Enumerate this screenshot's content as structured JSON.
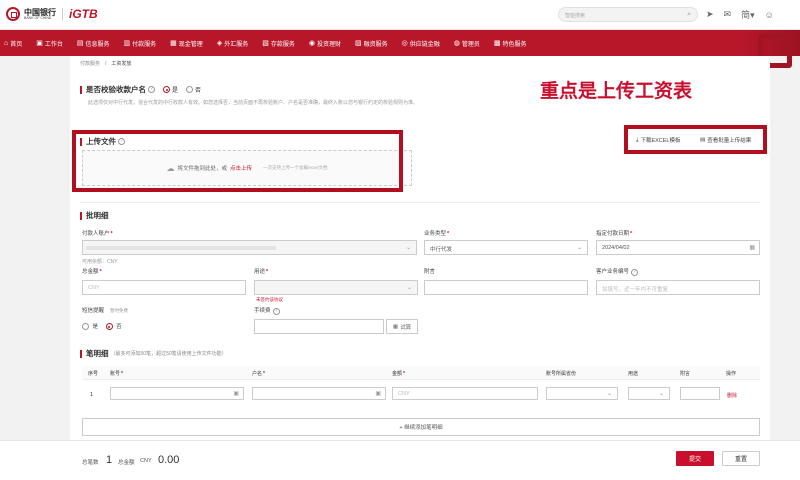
{
  "header": {
    "bank_name_cn": "中国银行",
    "bank_name_en": "BANK OF CHINA",
    "product": "iGTB",
    "search_placeholder": "智能搜索",
    "lang": "简"
  },
  "nav": [
    {
      "icon": "⌂",
      "label": "首页"
    },
    {
      "icon": "▣",
      "label": "工作台"
    },
    {
      "icon": "▤",
      "label": "信息服务"
    },
    {
      "icon": "▥",
      "label": "付款服务"
    },
    {
      "icon": "▦",
      "label": "现金管理"
    },
    {
      "icon": "◈",
      "label": "外汇服务"
    },
    {
      "icon": "▧",
      "label": "存款服务"
    },
    {
      "icon": "◉",
      "label": "投资理财"
    },
    {
      "icon": "▨",
      "label": "融资服务"
    },
    {
      "icon": "◎",
      "label": "供应链金融"
    },
    {
      "icon": "◍",
      "label": "管理员"
    },
    {
      "icon": "▩",
      "label": "特色服务"
    }
  ],
  "breadcrumb": {
    "parent": "付款服务",
    "sep": "/",
    "current": "工资发放"
  },
  "verify": {
    "title": "是否校验收款户名",
    "yes": "是",
    "no": "否",
    "hint": "此选项仅对中行代发。混合代发的中行收款人有效。如您选择否，当前页面不再校验账户、户名是否准确，最终入账以您与银行约定的校验规则为准。"
  },
  "overlay_note": "重点是上传工资表",
  "upload": {
    "title": "上传文件",
    "drag_text": "将文件拖到此处，或",
    "click_text": "点击上传",
    "limit_text": "一次支持上传一个加载excel文档",
    "download_template": "下载EXCEL模板",
    "view_results": "查看批量上传结果"
  },
  "batch": {
    "title": "批明细",
    "payer_label": "付款人账户",
    "available_label": "可用余额：CNY",
    "biz_type_label": "业务类型",
    "biz_type_value": "中行代发",
    "date_label": "指定付款日期",
    "date_value": "2024/04/02",
    "total_label": "总金额",
    "total_placeholder": "CNY",
    "usage_label": "用途",
    "usage_error": "未签约该协议",
    "remark_label": "附言",
    "customer_no_label": "客户业务编号",
    "customer_no_placeholder": "如填写，近一年内不可重复",
    "sms_label": "短信提醒",
    "sms_hint": "暂时免费",
    "sms_yes": "是",
    "sms_no": "否",
    "fee_label": "手续费",
    "trial_button": "试算"
  },
  "details": {
    "title": "笔明细",
    "subtitle": "（最多可添加50笔，超过50笔请使用上传文件功能）",
    "headers": [
      "序号",
      "账号",
      "户名",
      "金额",
      "账号所属省份",
      "用途",
      "附言",
      "操作"
    ],
    "row": {
      "index": "1",
      "amount_placeholder": "CNY",
      "delete": "删除"
    },
    "add_row": "+ 继续添加笔明细"
  },
  "footer": {
    "count_label": "总笔数",
    "count": "1",
    "amount_label": "总金额",
    "currency": "CNY",
    "amount": "0.00",
    "submit": "提交",
    "reset": "重置"
  },
  "colors": {
    "brand": "#b8172a",
    "accent": "#c8102e"
  }
}
